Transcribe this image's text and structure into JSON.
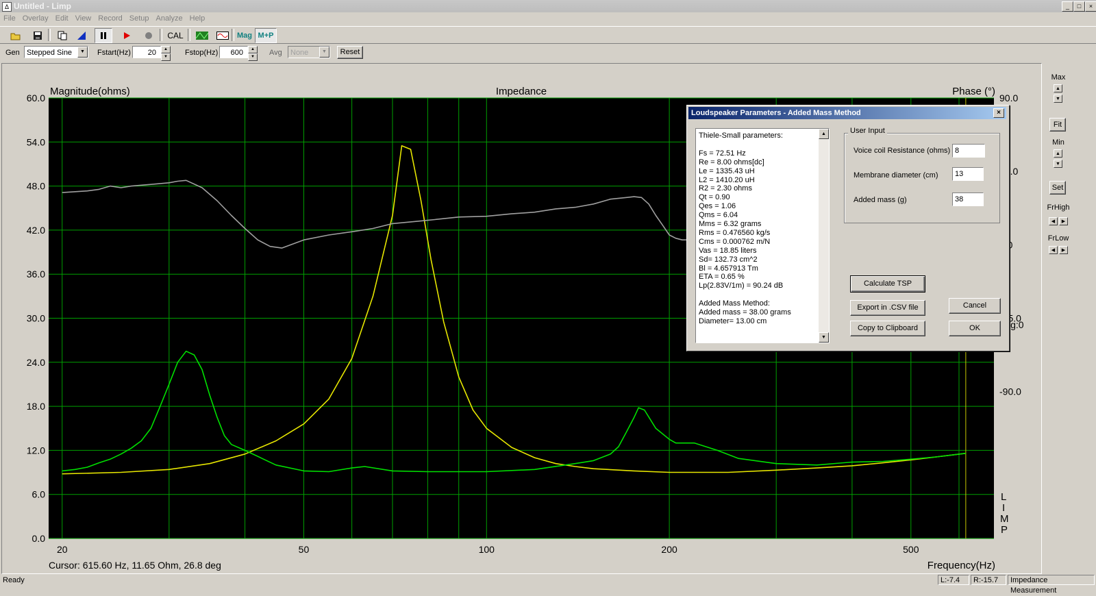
{
  "window": {
    "title": "Untitled - Limp",
    "min_label": "_",
    "max_label": "□",
    "close_label": "×"
  },
  "menu": [
    "File",
    "Overlay",
    "Edit",
    "View",
    "Record",
    "Setup",
    "Analyze",
    "Help"
  ],
  "toolbar": {
    "cal_label": "CAL",
    "mag_label": "Mag",
    "mp_label": "M+P"
  },
  "controls": {
    "gen_label": "Gen",
    "gen_value": "Stepped Sine",
    "fstart_label": "Fstart(Hz)",
    "fstart_value": "20",
    "fstop_label": "Fstop(Hz)",
    "fstop_value": "600",
    "avg_label": "Avg",
    "avg_value": "None",
    "reset_label": "Reset"
  },
  "plot": {
    "title": "Impedance",
    "left_axis_label": "Magnitude(ohms)",
    "right_axis_label": "Phase (°)",
    "x_axis_label": "Frequency(Hz)",
    "cursor_readout": "Cursor: 615.60 Hz, 11.65 Ohm, 26.8 deg",
    "avg_readout": "Avg:0",
    "vertical_brand": [
      "L",
      "I",
      "M",
      "P"
    ],
    "colors": {
      "background": "#000000",
      "grid": "#00a000",
      "magnitude": "#e6e600",
      "phase": "#00e000",
      "reference": "#a0a0a0",
      "cursor": "#c8c800"
    }
  },
  "chart_data": {
    "type": "line",
    "title": "Impedance",
    "xlabel": "Frequency(Hz)",
    "ylabel": "Magnitude(ohms)",
    "y2label": "Phase (°)",
    "xscale": "log",
    "xlim": [
      19,
      685
    ],
    "ylim": [
      0,
      60
    ],
    "y2lim": [
      -180,
      90
    ],
    "x_ticks": [
      20,
      50,
      100,
      200,
      500
    ],
    "y_ticks": [
      "0.0",
      "6.0",
      "12.0",
      "18.0",
      "24.0",
      "30.0",
      "36.0",
      "42.0",
      "48.0",
      "54.0",
      "60.0"
    ],
    "y2_ticks": [
      "90.0",
      "45.0",
      "0.0",
      "-45.0",
      "-90.0"
    ],
    "grid": true,
    "cursor_x": 615.6,
    "series": [
      {
        "axis": "left",
        "color": "#e6e600",
        "points": [
          [
            20,
            8.8
          ],
          [
            25,
            9.0
          ],
          [
            30,
            9.4
          ],
          [
            35,
            10.2
          ],
          [
            40,
            11.5
          ],
          [
            45,
            13.3
          ],
          [
            50,
            15.6
          ],
          [
            55,
            19
          ],
          [
            60,
            24.5
          ],
          [
            65,
            33
          ],
          [
            70,
            44
          ],
          [
            72.5,
            53.5
          ],
          [
            75,
            53
          ],
          [
            78,
            46
          ],
          [
            81,
            38
          ],
          [
            85,
            29.5
          ],
          [
            90,
            22
          ],
          [
            95,
            17.5
          ],
          [
            100,
            15
          ],
          [
            110,
            12.4
          ],
          [
            120,
            11
          ],
          [
            130,
            10.2
          ],
          [
            140,
            9.8
          ],
          [
            150,
            9.5
          ],
          [
            175,
            9.2
          ],
          [
            200,
            9.0
          ],
          [
            250,
            9.0
          ],
          [
            300,
            9.3
          ],
          [
            350,
            9.6
          ],
          [
            400,
            9.9
          ],
          [
            450,
            10.3
          ],
          [
            500,
            10.7
          ],
          [
            550,
            11.1
          ],
          [
            616,
            11.6
          ]
        ]
      },
      {
        "axis": "left",
        "color": "#00e000",
        "points": [
          [
            20,
            9.2
          ],
          [
            21,
            9.4
          ],
          [
            22,
            9.7
          ],
          [
            23,
            10.3
          ],
          [
            24,
            10.8
          ],
          [
            25,
            11.5
          ],
          [
            26,
            12.3
          ],
          [
            27,
            13.3
          ],
          [
            28,
            15
          ],
          [
            29,
            18
          ],
          [
            30,
            21
          ],
          [
            31,
            24
          ],
          [
            32,
            25.5
          ],
          [
            33,
            25
          ],
          [
            34,
            23
          ],
          [
            35,
            19.5
          ],
          [
            36,
            16.5
          ],
          [
            37,
            14
          ],
          [
            38,
            12.8
          ],
          [
            40,
            12
          ],
          [
            45,
            10
          ],
          [
            50,
            9.2
          ],
          [
            55,
            9.1
          ],
          [
            60,
            9.6
          ],
          [
            63,
            9.8
          ],
          [
            70,
            9.2
          ],
          [
            80,
            9.1
          ],
          [
            100,
            9.1
          ],
          [
            120,
            9.4
          ],
          [
            140,
            10.2
          ],
          [
            150,
            10.6
          ],
          [
            160,
            11.5
          ],
          [
            165,
            12.5
          ],
          [
            170,
            14.5
          ],
          [
            175,
            16.5
          ],
          [
            178,
            17.8
          ],
          [
            182,
            17.5
          ],
          [
            190,
            15
          ],
          [
            200,
            13.5
          ],
          [
            205,
            13
          ],
          [
            220,
            13
          ],
          [
            240,
            12
          ],
          [
            260,
            10.9
          ],
          [
            300,
            10.2
          ],
          [
            350,
            10
          ],
          [
            400,
            10.4
          ],
          [
            450,
            10.5
          ],
          [
            500,
            10.8
          ],
          [
            550,
            11.1
          ],
          [
            616,
            11.6
          ]
        ]
      },
      {
        "axis": "right",
        "color": "#a0a0a0",
        "points": [
          [
            20,
            32
          ],
          [
            22,
            33
          ],
          [
            23,
            34
          ],
          [
            24,
            36
          ],
          [
            25,
            35
          ],
          [
            26,
            36
          ],
          [
            28,
            37
          ],
          [
            30,
            38
          ],
          [
            31,
            39
          ],
          [
            32,
            39.5
          ],
          [
            34,
            35
          ],
          [
            36,
            27
          ],
          [
            38,
            18
          ],
          [
            40,
            10
          ],
          [
            42,
            3
          ],
          [
            44,
            -1
          ],
          [
            46,
            -2
          ],
          [
            50,
            3
          ],
          [
            55,
            6
          ],
          [
            60,
            8
          ],
          [
            65,
            10
          ],
          [
            70,
            13
          ],
          [
            80,
            15
          ],
          [
            90,
            17
          ],
          [
            100,
            17.5
          ],
          [
            110,
            19
          ],
          [
            120,
            20
          ],
          [
            130,
            22
          ],
          [
            140,
            23
          ],
          [
            150,
            25
          ],
          [
            160,
            28
          ],
          [
            170,
            29
          ],
          [
            175,
            29.5
          ],
          [
            180,
            29
          ],
          [
            185,
            25
          ],
          [
            190,
            18
          ],
          [
            195,
            12
          ],
          [
            200,
            6
          ],
          [
            205,
            4
          ],
          [
            210,
            3
          ],
          [
            225,
            3
          ],
          [
            240,
            5
          ]
        ]
      }
    ]
  },
  "right_panel": {
    "max_label": "Max",
    "fit_label": "Fit",
    "min_label": "Min",
    "set_label": "Set",
    "frhigh_label": "FrHigh",
    "frlow_label": "FrLow"
  },
  "status": {
    "ready": "Ready",
    "left": "L:-7.4",
    "right": "R:-15.7",
    "mode": "Impedance Measurement"
  },
  "dialog": {
    "title": "Loudspeaker Parameters - Added Mass Method",
    "close_label": "×",
    "params_lines": [
      "Thiele-Small parameters:",
      "",
      "Fs  = 72.51 Hz",
      "Re  = 8.00 ohms[dc]",
      "Le  = 1335.43 uH",
      "L2  = 1410.20 uH",
      "R2  = 2.30 ohms",
      "Qt  = 0.90",
      "Qes = 1.06",
      "Qms = 6.04",
      "Mms = 6.32 grams",
      "Rms = 0.476560 kg/s",
      "Cms = 0.000762 m/N",
      "Vas = 18.85 liters",
      "Sd= 132.73 cm^2",
      "Bl  = 4.657913 Tm",
      "ETA = 0.65 %",
      "Lp(2.83V/1m) = 90.24 dB",
      "",
      "Added Mass Method:",
      "Added mass = 38.00 grams",
      "Diameter= 13.00 cm"
    ],
    "user_input_label": "User Input",
    "vc_label": "Voice coil Resistance (ohms)",
    "vc_value": "8",
    "md_label": "Membrane diameter (cm)",
    "md_value": "13",
    "am_label": "Added mass (g)",
    "am_value": "38",
    "calc_label": "Calculate TSP",
    "export_label": "Export in .CSV file",
    "copy_label": "Copy to Clipboard",
    "cancel_label": "Cancel",
    "ok_label": "OK"
  }
}
